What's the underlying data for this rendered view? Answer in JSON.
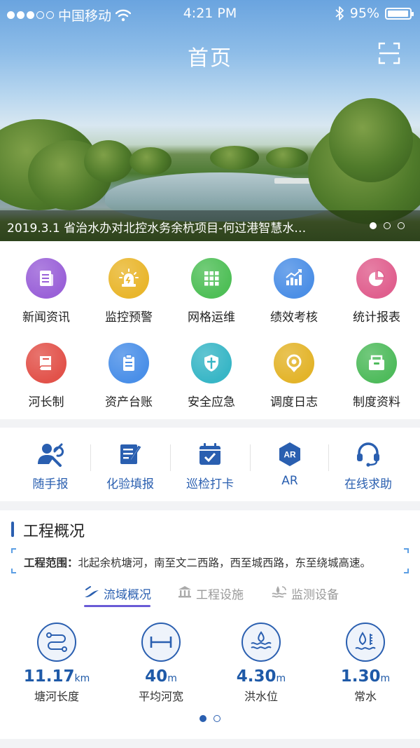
{
  "status_bar": {
    "carrier": "中国移动",
    "time": "4:21 PM",
    "battery": "95%",
    "battery_level": 0.95,
    "signal_bars": 3,
    "signal_total": 5
  },
  "header": {
    "title": "首页"
  },
  "banner": {
    "caption": "2019.3.1 省治水办对北控水务余杭项目-何过港智慧水务...",
    "slide_count": 3,
    "active_slide": 1
  },
  "grid_menu": [
    {
      "label": "新闻资讯",
      "icon": "news-icon",
      "color": "#9a61d8"
    },
    {
      "label": "监控预警",
      "icon": "alarm-icon",
      "color": "#e9b62c"
    },
    {
      "label": "网格运维",
      "icon": "grid-icon",
      "color": "#4fbf57"
    },
    {
      "label": "绩效考核",
      "icon": "performance-chart-icon",
      "color": "#4c8fe6"
    },
    {
      "label": "统计报表",
      "icon": "pie-chart-icon",
      "color": "#e05f8e"
    },
    {
      "label": "河长制",
      "icon": "book-icon",
      "color": "#e2524a"
    },
    {
      "label": "资产台账",
      "icon": "clipboard-icon",
      "color": "#4a8fe8"
    },
    {
      "label": "安全应急",
      "icon": "shield-icon",
      "color": "#38b6c6"
    },
    {
      "label": "调度日志",
      "icon": "location-refresh-icon",
      "color": "#e3b42a"
    },
    {
      "label": "制度资料",
      "icon": "file-box-icon",
      "color": "#4fbb5c"
    }
  ],
  "quick_actions": [
    {
      "label": "随手报",
      "icon": "user-wrench-icon"
    },
    {
      "label": "化验填报",
      "icon": "edit-form-icon"
    },
    {
      "label": "巡检打卡",
      "icon": "calendar-check-icon"
    },
    {
      "label": "AR",
      "icon": "ar-badge-icon"
    },
    {
      "label": "在线求助",
      "icon": "headset-icon"
    }
  ],
  "overview": {
    "title": "工程概况",
    "range_label": "工程范围：",
    "range_text": "北起余杭塘河，南至文二西路，西至城西路，东至绕城高速。",
    "tabs": [
      {
        "label": "流域概况",
        "icon": "river-icon",
        "active": true
      },
      {
        "label": "工程设施",
        "icon": "building-icon",
        "active": false
      },
      {
        "label": "监测设备",
        "icon": "monitor-wave-icon",
        "active": false
      }
    ],
    "stats": [
      {
        "value": "11.17",
        "unit": "km",
        "label": "塘河长度",
        "icon": "river-path-icon"
      },
      {
        "value": "40",
        "unit": "m",
        "label": "平均河宽",
        "icon": "width-icon"
      },
      {
        "value": "4.30",
        "unit": "m",
        "label": "洪水位",
        "icon": "flood-level-icon"
      },
      {
        "value": "1.30",
        "unit": "m",
        "label": "常水",
        "icon": "water-level-icon"
      }
    ],
    "page_count": 2,
    "active_page": 1
  },
  "colors": {
    "primary": "#2a5fb0",
    "tab_underline": "#6a5bd6",
    "bracket": "#5b9ee4"
  }
}
